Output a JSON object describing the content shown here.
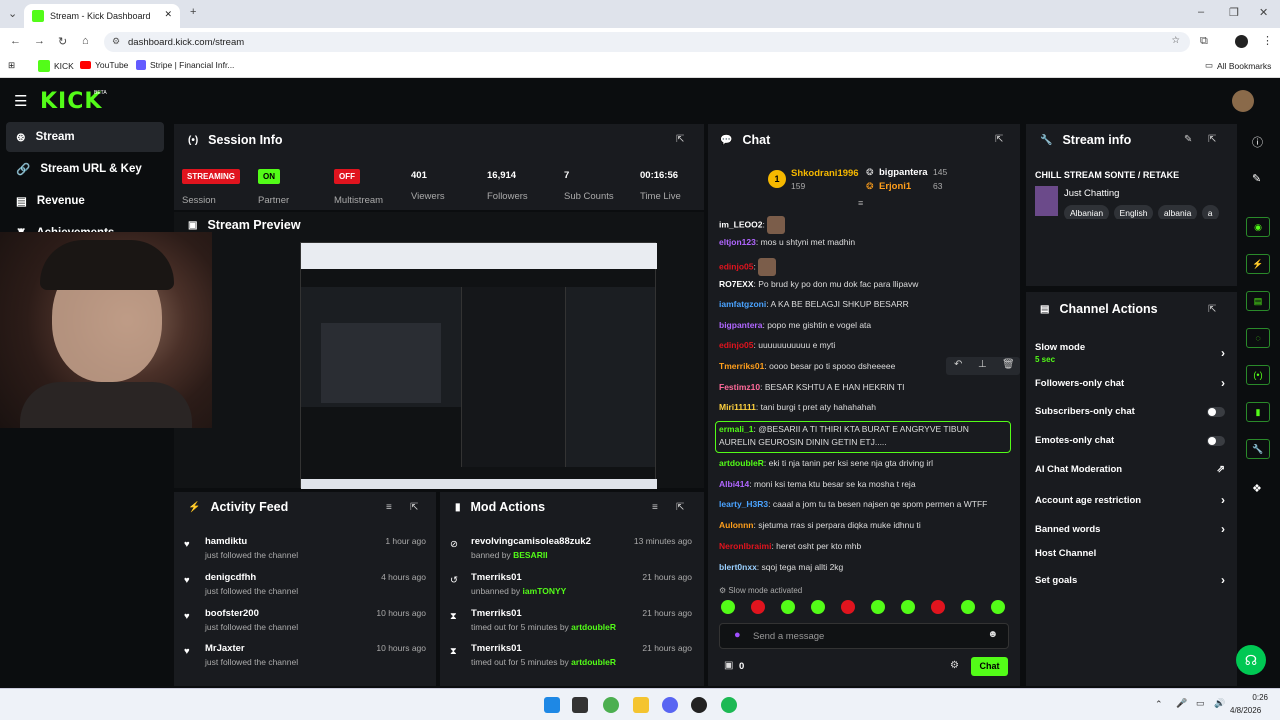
{
  "browser": {
    "tab_title": "Stream - Kick Dashboard",
    "url": "dashboard.kick.com/stream",
    "bookmarks": [
      "KICK",
      "YouTube",
      "Stripe | Financial Infr..."
    ],
    "all_bookmarks": "All Bookmarks"
  },
  "app": {
    "logo": "KICK",
    "beta": "BETA"
  },
  "sidebar": {
    "items": [
      {
        "label": "Stream",
        "icon": "broadcast-icon"
      },
      {
        "label": "Stream URL & Key",
        "icon": "link-icon"
      },
      {
        "label": "Revenue",
        "icon": "chart-icon"
      },
      {
        "label": "Achievements",
        "icon": "trophy-icon"
      }
    ]
  },
  "session": {
    "title": "Session Info",
    "stats": [
      {
        "value": "STREAMING",
        "label": "Session",
        "kind": "badge",
        "color": "#e0141e"
      },
      {
        "value": "ON",
        "label": "Partner",
        "kind": "badge",
        "color": "#53fc18"
      },
      {
        "value": "OFF",
        "label": "Multistream",
        "kind": "badge",
        "color": "#e0141e"
      },
      {
        "value": "401",
        "label": "Viewers"
      },
      {
        "value": "16,914",
        "label": "Followers"
      },
      {
        "value": "7",
        "label": "Sub Counts"
      },
      {
        "value": "00:16:56",
        "label": "Time Live"
      }
    ]
  },
  "preview": {
    "title": "Stream Preview"
  },
  "activity": {
    "title": "Activity Feed",
    "items": [
      {
        "name": "hamdiktu",
        "desc": "just followed the channel",
        "time": "1 hour ago"
      },
      {
        "name": "denigcdfhh",
        "desc": "just followed the channel",
        "time": "4 hours ago"
      },
      {
        "name": "boofster200",
        "desc": "just followed the channel",
        "time": "10 hours ago"
      },
      {
        "name": "MrJaxter",
        "desc": "just followed the channel",
        "time": "10 hours ago"
      }
    ]
  },
  "mod": {
    "title": "Mod Actions",
    "items": [
      {
        "name": "revolvingcamisolea88zuk2",
        "desc": "banned by",
        "by": "BESARII",
        "time": "13 minutes ago",
        "icon": "ban-icon"
      },
      {
        "name": "Tmerriks01",
        "desc": "unbanned by",
        "by": "iamTONYY",
        "time": "21 hours ago",
        "icon": "undo-icon"
      },
      {
        "name": "Tmerriks01",
        "desc": "timed out for 5 minutes by",
        "by": "artdoubleR",
        "time": "21 hours ago",
        "icon": "hourglass-icon"
      },
      {
        "name": "Tmerriks01",
        "desc": "timed out for 5 minutes by",
        "by": "artdoubleR",
        "time": "21 hours ago",
        "icon": "hourglass-icon"
      }
    ]
  },
  "chat": {
    "title": "Chat",
    "leaderboard": [
      {
        "rank": "1",
        "name": "Shkodrani1996",
        "count": "159"
      },
      {
        "name": "bigpantera",
        "count": "145"
      },
      {
        "name": "Erjoni1",
        "count": "63"
      }
    ],
    "messages": [
      {
        "user": "im_LEOO2",
        "text": "",
        "color": "#ffffff",
        "emote": true
      },
      {
        "user": "eltjon123",
        "text": "mos u shtyni met madhin",
        "color": "#b066ff"
      },
      {
        "user": "edinjo05",
        "text": "",
        "color": "#e0141e",
        "emote": true
      },
      {
        "user": "RO7EXX",
        "text": "Po brud ky po don mu dok fac para llipavw",
        "color": "#ffffff"
      },
      {
        "user": "iamfatgzoni",
        "text": "A KA BE BELAGJI SHKUP BESARR",
        "color": "#4aa3ff"
      },
      {
        "user": "bigpantera",
        "text": "popo me gishtin e vogel ata",
        "color": "#b066ff"
      },
      {
        "user": "edinjo05",
        "text": "uuuuuuuuuuu e myti",
        "color": "#e0141e"
      },
      {
        "user": "Tmerriks01",
        "text": "oooo besar po ti spooo dsheeeee",
        "color": "#ff9f1c"
      },
      {
        "user": "Festimz10",
        "text": "BESAR KSHTU A E HAN HEKRIN TI",
        "color": "#ff6b9a"
      },
      {
        "user": "Miri11111",
        "text": "tani burgi t pret aty hahahahah",
        "color": "#ffd23f"
      },
      {
        "user": "ermali_1",
        "text": "@BESARII A TI THIRI KTA BURAT E ANGRYVE TIBUN AURELIN GEUROSIN DININ GETIN ETJ.....",
        "color": "#53fc18"
      },
      {
        "user": "artdoubleR",
        "text": "eki ti nja tanin per ksi sene nja gta driving irl",
        "color": "#53fc18"
      },
      {
        "user": "Albi414",
        "text": "moni ksi tema ktu besar se ka mosha t reja",
        "color": "#b066ff"
      },
      {
        "user": "learty_H3R3",
        "text": "caaal a jom tu ta besen najsen qe spom permen a WTFF",
        "color": "#4aa3ff"
      },
      {
        "user": "Aulonnn",
        "text": "sjetuma rras si perpara diqka muke idhnu ti",
        "color": "#ff9f1c"
      },
      {
        "user": "Neronlbraimi",
        "text": "heret osht per kto mhb",
        "color": "#e0141e"
      },
      {
        "user": "blert0nxx",
        "text": "sqoj tega maj allti 2kg",
        "color": "#9ad0ff"
      }
    ],
    "slow_mode_notice": "Slow mode activated",
    "input_placeholder": "Send a message",
    "bottom_count": "0",
    "send_label": "Chat"
  },
  "stream_info": {
    "title": "Stream info",
    "stream_title": "CHILL STREAM SONTE / RETAKE",
    "category": "Just Chatting",
    "tags": [
      "Albanian",
      "English",
      "albania",
      "a"
    ]
  },
  "channel_actions": {
    "title": "Channel Actions",
    "items": [
      {
        "label": "Slow mode",
        "sub": "5 sec",
        "control": "arrow"
      },
      {
        "label": "Followers-only chat",
        "control": "arrow"
      },
      {
        "label": "Subscribers-only chat",
        "control": "toggle"
      },
      {
        "label": "Emotes-only chat",
        "control": "toggle"
      },
      {
        "label": "AI Chat Moderation",
        "control": "external"
      },
      {
        "label": "Account age restriction",
        "control": "arrow"
      },
      {
        "label": "Banned words",
        "control": "arrow"
      },
      {
        "label": "Host Channel",
        "control": "none"
      },
      {
        "label": "Set goals",
        "control": "arrow"
      }
    ]
  },
  "taskbar": {
    "time": "0:26",
    "date": "4/8/2026"
  },
  "colors": {
    "accent": "#53fc18",
    "live": "#e0141e",
    "panel": "#191b1f"
  }
}
